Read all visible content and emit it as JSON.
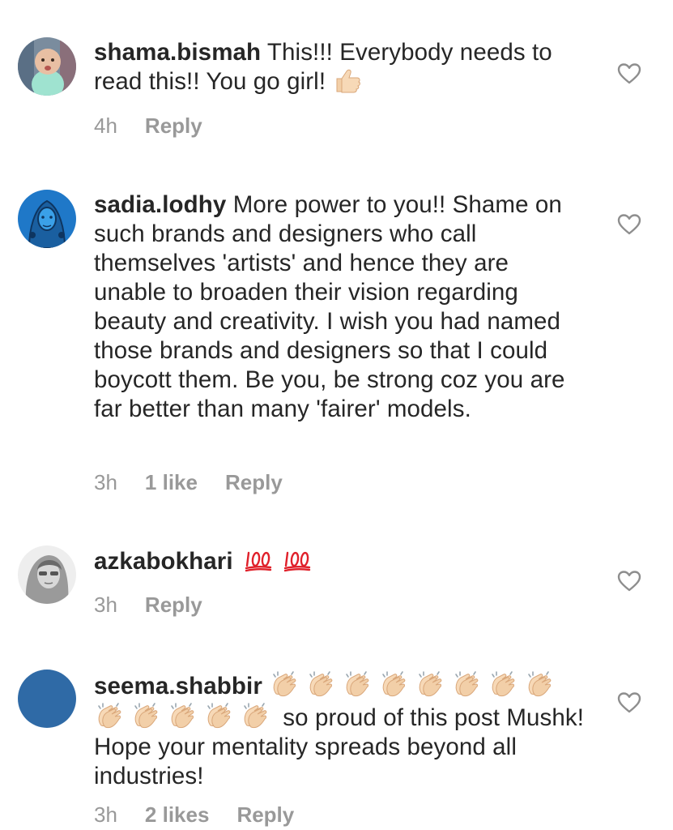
{
  "comments": [
    {
      "username": "shama.bismah",
      "text": "This!!! Everybody needs to read this!! You go girl!",
      "emoji": "thumbs-up",
      "time": "4h",
      "likes": "",
      "reply": "Reply",
      "avatar_icon": "baby-photo"
    },
    {
      "username": "sadia.lodhy",
      "text": "More power to you!! Shame on such brands and designers who call themselves 'artists' and hence they are unable to broaden their vision regarding beauty and creativity. I wish you had named those brands and designers so that I could boycott them. Be you, be strong coz you are far better than many 'fairer' models.",
      "time": "3h",
      "likes": "1 like",
      "reply": "Reply",
      "avatar_icon": "blue-illustration"
    },
    {
      "username": "azkabokhari",
      "text": "",
      "emoji": "hundred-points x2",
      "time": "3h",
      "likes": "",
      "reply": "Reply",
      "avatar_icon": "grayscale-portrait"
    },
    {
      "username": "seema.shabbir",
      "text": "so proud of this post Mushk! Hope your mentality spreads beyond all industries!",
      "emoji": "clapping-hands x13",
      "time": "3h",
      "likes": "2 likes",
      "reply": "Reply",
      "avatar_icon": "solid-blue-circle"
    }
  ],
  "colors": {
    "text": "#262626",
    "meta": "#999999",
    "heart": "#8e8e8e",
    "avatar_blue": "#2f6aa6"
  }
}
